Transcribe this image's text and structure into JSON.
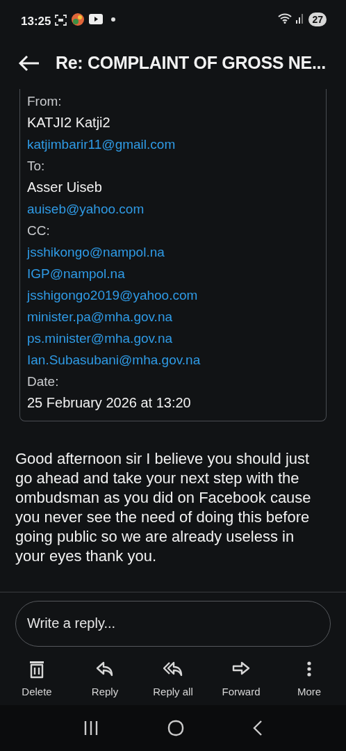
{
  "status_bar": {
    "time": "13:25",
    "battery": "27"
  },
  "header": {
    "title": "Re: COMPLAINT OF GROSS NE..."
  },
  "details": [
    {
      "kind": "label",
      "text": "From:"
    },
    {
      "kind": "value",
      "text": "KATJI2 Katji2"
    },
    {
      "kind": "link",
      "text": "katjimbarir11@gmail.com"
    },
    {
      "kind": "label",
      "text": "To:"
    },
    {
      "kind": "value",
      "text": "Asser Uiseb"
    },
    {
      "kind": "link",
      "text": "auiseb@yahoo.com"
    },
    {
      "kind": "label",
      "text": "CC:"
    },
    {
      "kind": "link",
      "text": "jsshikongo@nampol.na"
    },
    {
      "kind": "link",
      "text": "IGP@nampol.na"
    },
    {
      "kind": "link",
      "text": "jsshigongo2019@yahoo.com"
    },
    {
      "kind": "link",
      "text": "minister.pa@mha.gov.na"
    },
    {
      "kind": "link",
      "text": "ps.minister@mha.gov.na"
    },
    {
      "kind": "link",
      "text": "Ian.Subasubani@mha.gov.na"
    },
    {
      "kind": "label",
      "text": "Date:"
    },
    {
      "kind": "value",
      "text": "25 February 2026 at 13:20"
    }
  ],
  "message": "Good afternoon sir I believe you should just go ahead and take your next step with the ombudsman as you did on Facebook cause you never see the need of doing this before going public so we are already useless in your eyes thank you.",
  "reply_field": {
    "placeholder": "Write a reply..."
  },
  "actions": [
    {
      "kind": "delete",
      "label": "Delete"
    },
    {
      "kind": "reply",
      "label": "Reply"
    },
    {
      "kind": "reply_all",
      "label": "Reply all"
    },
    {
      "kind": "forward",
      "label": "Forward"
    },
    {
      "kind": "more",
      "label": "More"
    }
  ]
}
